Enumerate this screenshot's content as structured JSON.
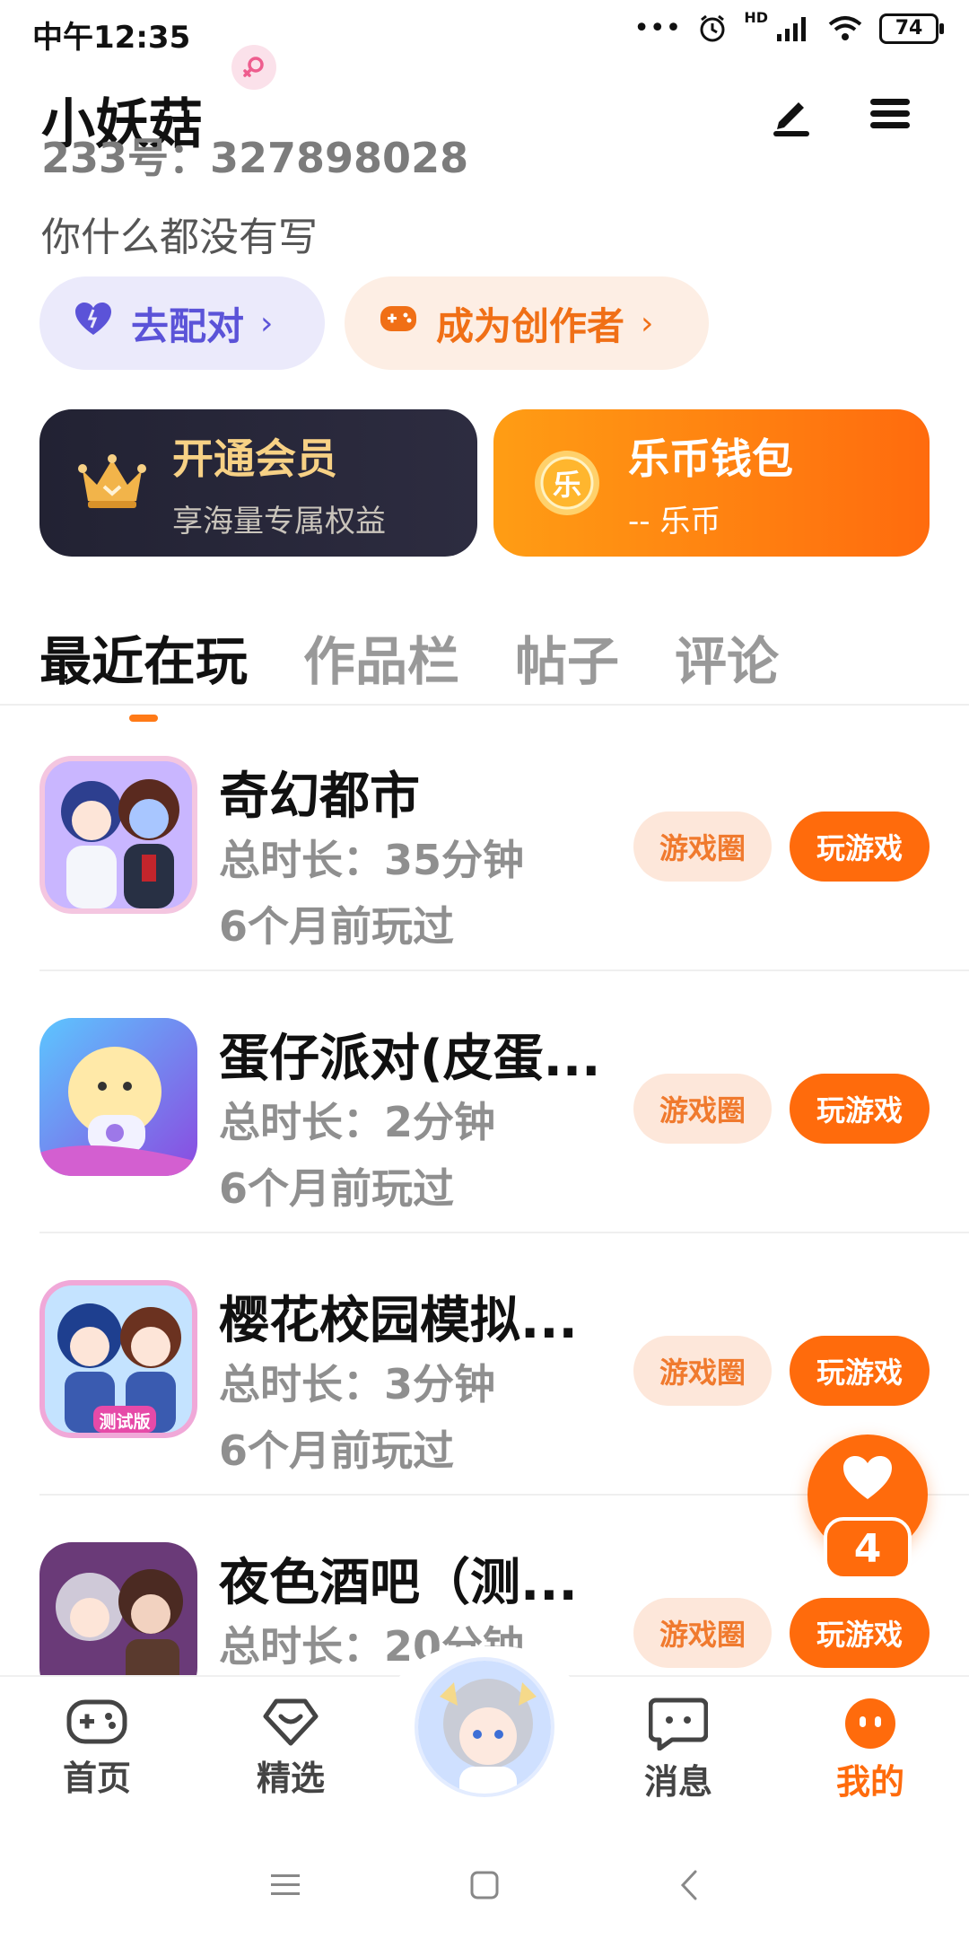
{
  "status_bar": {
    "time": "中午12:35",
    "dots": "•••",
    "network": "HD",
    "battery": "74"
  },
  "profile": {
    "gender_icon": "female-icon",
    "username": "小妖菇",
    "uid": "233号：327898028",
    "bio": "你什么都没有写",
    "match_label": "去配对",
    "creator_label": "成为创作者"
  },
  "cards": {
    "vip_title": "开通会员",
    "vip_sub": "享海量专属权益",
    "wallet_title": "乐币钱包",
    "wallet_sub": "-- 乐币",
    "wallet_coin": "乐"
  },
  "tabs": [
    "最近在玩",
    "作品栏",
    "帖子",
    "评论"
  ],
  "games": [
    {
      "name": "奇幻都市",
      "time": "总时长：35分钟",
      "last": "6个月前玩过",
      "circle": "游戏圈",
      "play": "玩游戏"
    },
    {
      "name": "蛋仔派对(皮蛋...",
      "time": "总时长：2分钟",
      "last": "6个月前玩过",
      "circle": "游戏圈",
      "play": "玩游戏"
    },
    {
      "name": "樱花校园模拟...",
      "time": "总时长：3分钟",
      "last": "6个月前玩过",
      "circle": "游戏圈",
      "play": "玩游戏"
    },
    {
      "name": "夜色酒吧（测...",
      "time": "总时长：20分钟",
      "last": "",
      "circle": "游戏圈",
      "play": "玩游戏"
    }
  ],
  "game_icon_badge": "测试版",
  "float": {
    "count": "4"
  },
  "bottom_nav": {
    "home": "首页",
    "featured": "精选",
    "messages": "消息",
    "mine": "我的"
  },
  "colors": {
    "accent": "#ff6b0c",
    "match": "#5b53d8",
    "vip_gold": "#f7d185"
  }
}
